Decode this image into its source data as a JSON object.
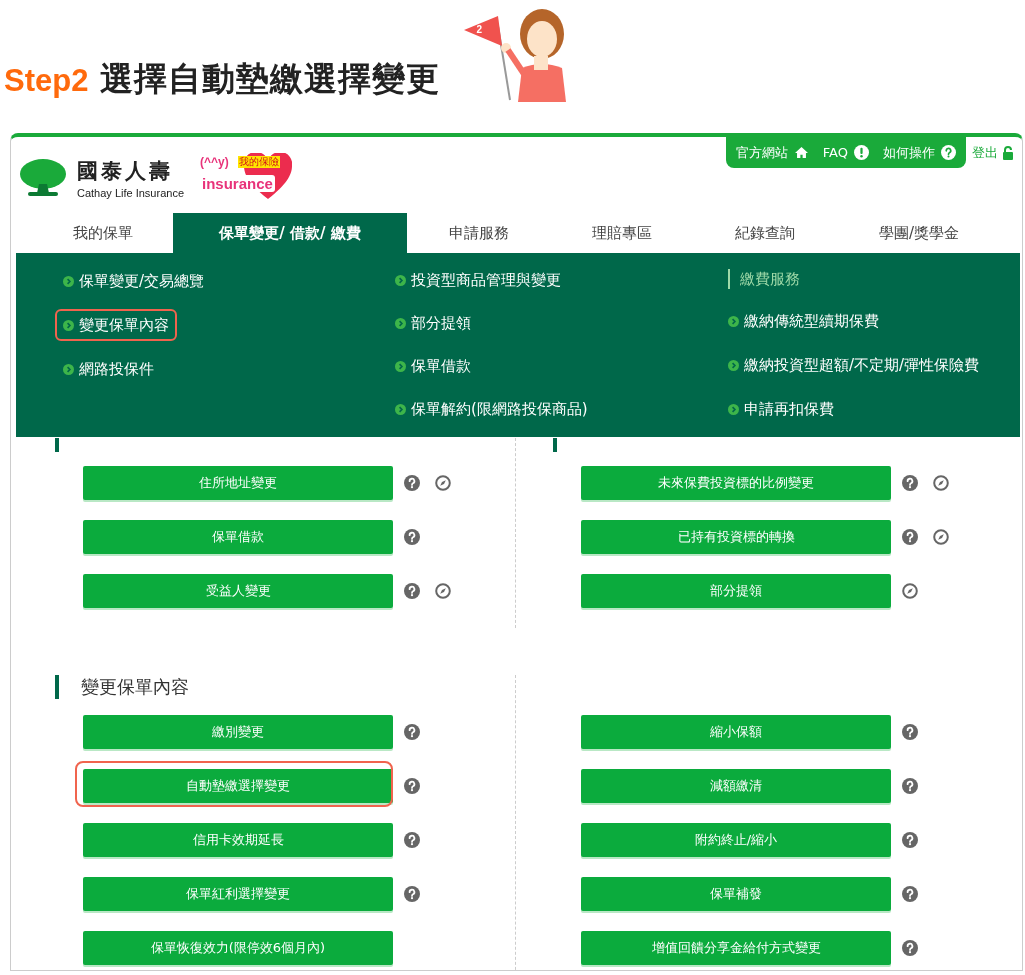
{
  "header": {
    "step": "Step2",
    "title": "選擇自動墊繳選擇變更",
    "flag_label": "2"
  },
  "brand": {
    "name": "國泰人壽",
    "subtitle": "Cathay Life Insurance",
    "badge_face": "(^^y)",
    "badge_tag": "我的保險",
    "badge_word": "insurance"
  },
  "top_links": [
    {
      "label": "官方網站",
      "kind": "home"
    },
    {
      "label": "FAQ",
      "kind": "faq"
    },
    {
      "label": "如何操作",
      "kind": "help"
    }
  ],
  "logout": {
    "label": "登出"
  },
  "nav_tabs": [
    {
      "label": "我的保單",
      "selected": false
    },
    {
      "label": "保單變更/ 借款/ 繳費",
      "selected": true
    },
    {
      "label": "申請服務",
      "selected": false
    },
    {
      "label": "理賠專區",
      "selected": false
    },
    {
      "label": "紀錄查詢",
      "selected": false
    },
    {
      "label": "學團/獎學金",
      "selected": false
    }
  ],
  "menu_columns": [
    [
      {
        "kind": "link",
        "label": "保單變更/交易總覽",
        "highlighted": false
      },
      {
        "kind": "link",
        "label": "變更保單內容",
        "highlighted": true
      },
      {
        "kind": "link",
        "label": "網路投保件",
        "highlighted": false
      }
    ],
    [
      {
        "kind": "link",
        "label": "投資型商品管理與變更",
        "highlighted": false
      },
      {
        "kind": "link",
        "label": "部分提領",
        "highlighted": false
      },
      {
        "kind": "link",
        "label": "保單借款",
        "highlighted": false
      },
      {
        "kind": "link",
        "label": "保單解約(限網路投保商品)",
        "highlighted": false
      }
    ],
    [
      {
        "kind": "heading",
        "label": "繳費服務"
      },
      {
        "kind": "link",
        "label": "繳納傳統型續期保費",
        "highlighted": false
      },
      {
        "kind": "link",
        "label": "繳納投資型超額/不定期/彈性保險費",
        "highlighted": false
      },
      {
        "kind": "link",
        "label": "申請再扣保費",
        "highlighted": false
      }
    ]
  ],
  "sections": [
    {
      "columns": [
        {
          "heading_cut": true,
          "buttons": [
            {
              "label": "住所地址變更",
              "highlighted": false,
              "has_help": true,
              "has_guide": true
            },
            {
              "label": "保單借款",
              "highlighted": false,
              "has_help": true,
              "has_guide": false
            },
            {
              "label": "受益人變更",
              "highlighted": false,
              "has_help": true,
              "has_guide": true
            }
          ]
        },
        {
          "heading_cut": true,
          "buttons": [
            {
              "label": "未來保費投資標的比例變更",
              "highlighted": false,
              "has_help": true,
              "has_guide": true
            },
            {
              "label": "已持有投資標的轉換",
              "highlighted": false,
              "has_help": true,
              "has_guide": true
            },
            {
              "label": "部分提領",
              "highlighted": false,
              "has_help": false,
              "has_guide": true
            }
          ]
        }
      ]
    },
    {
      "columns": [
        {
          "title": "變更保單內容",
          "buttons": [
            {
              "label": "繳別變更",
              "highlighted": false,
              "has_help": true,
              "has_guide": false
            },
            {
              "label": "自動墊繳選擇變更",
              "highlighted": true,
              "has_help": true,
              "has_guide": false
            },
            {
              "label": "信用卡效期延長",
              "highlighted": false,
              "has_help": true,
              "has_guide": false
            },
            {
              "label": "保單紅利選擇變更",
              "highlighted": false,
              "has_help": true,
              "has_guide": false
            },
            {
              "label": "保單恢復效力(限停效6個月內)",
              "highlighted": false,
              "has_help": false,
              "has_guide": false
            }
          ]
        },
        {
          "buttons": [
            {
              "label": "縮小保額",
              "highlighted": false,
              "has_help": true,
              "has_guide": false
            },
            {
              "label": "減額繳清",
              "highlighted": false,
              "has_help": true,
              "has_guide": false
            },
            {
              "label": "附約終止/縮小",
              "highlighted": false,
              "has_help": true,
              "has_guide": false
            },
            {
              "label": "保單補發",
              "highlighted": false,
              "has_help": true,
              "has_guide": false
            },
            {
              "label": "增值回饋分享金給付方式變更",
              "highlighted": false,
              "has_help": true,
              "has_guide": false
            }
          ]
        }
      ]
    }
  ]
}
